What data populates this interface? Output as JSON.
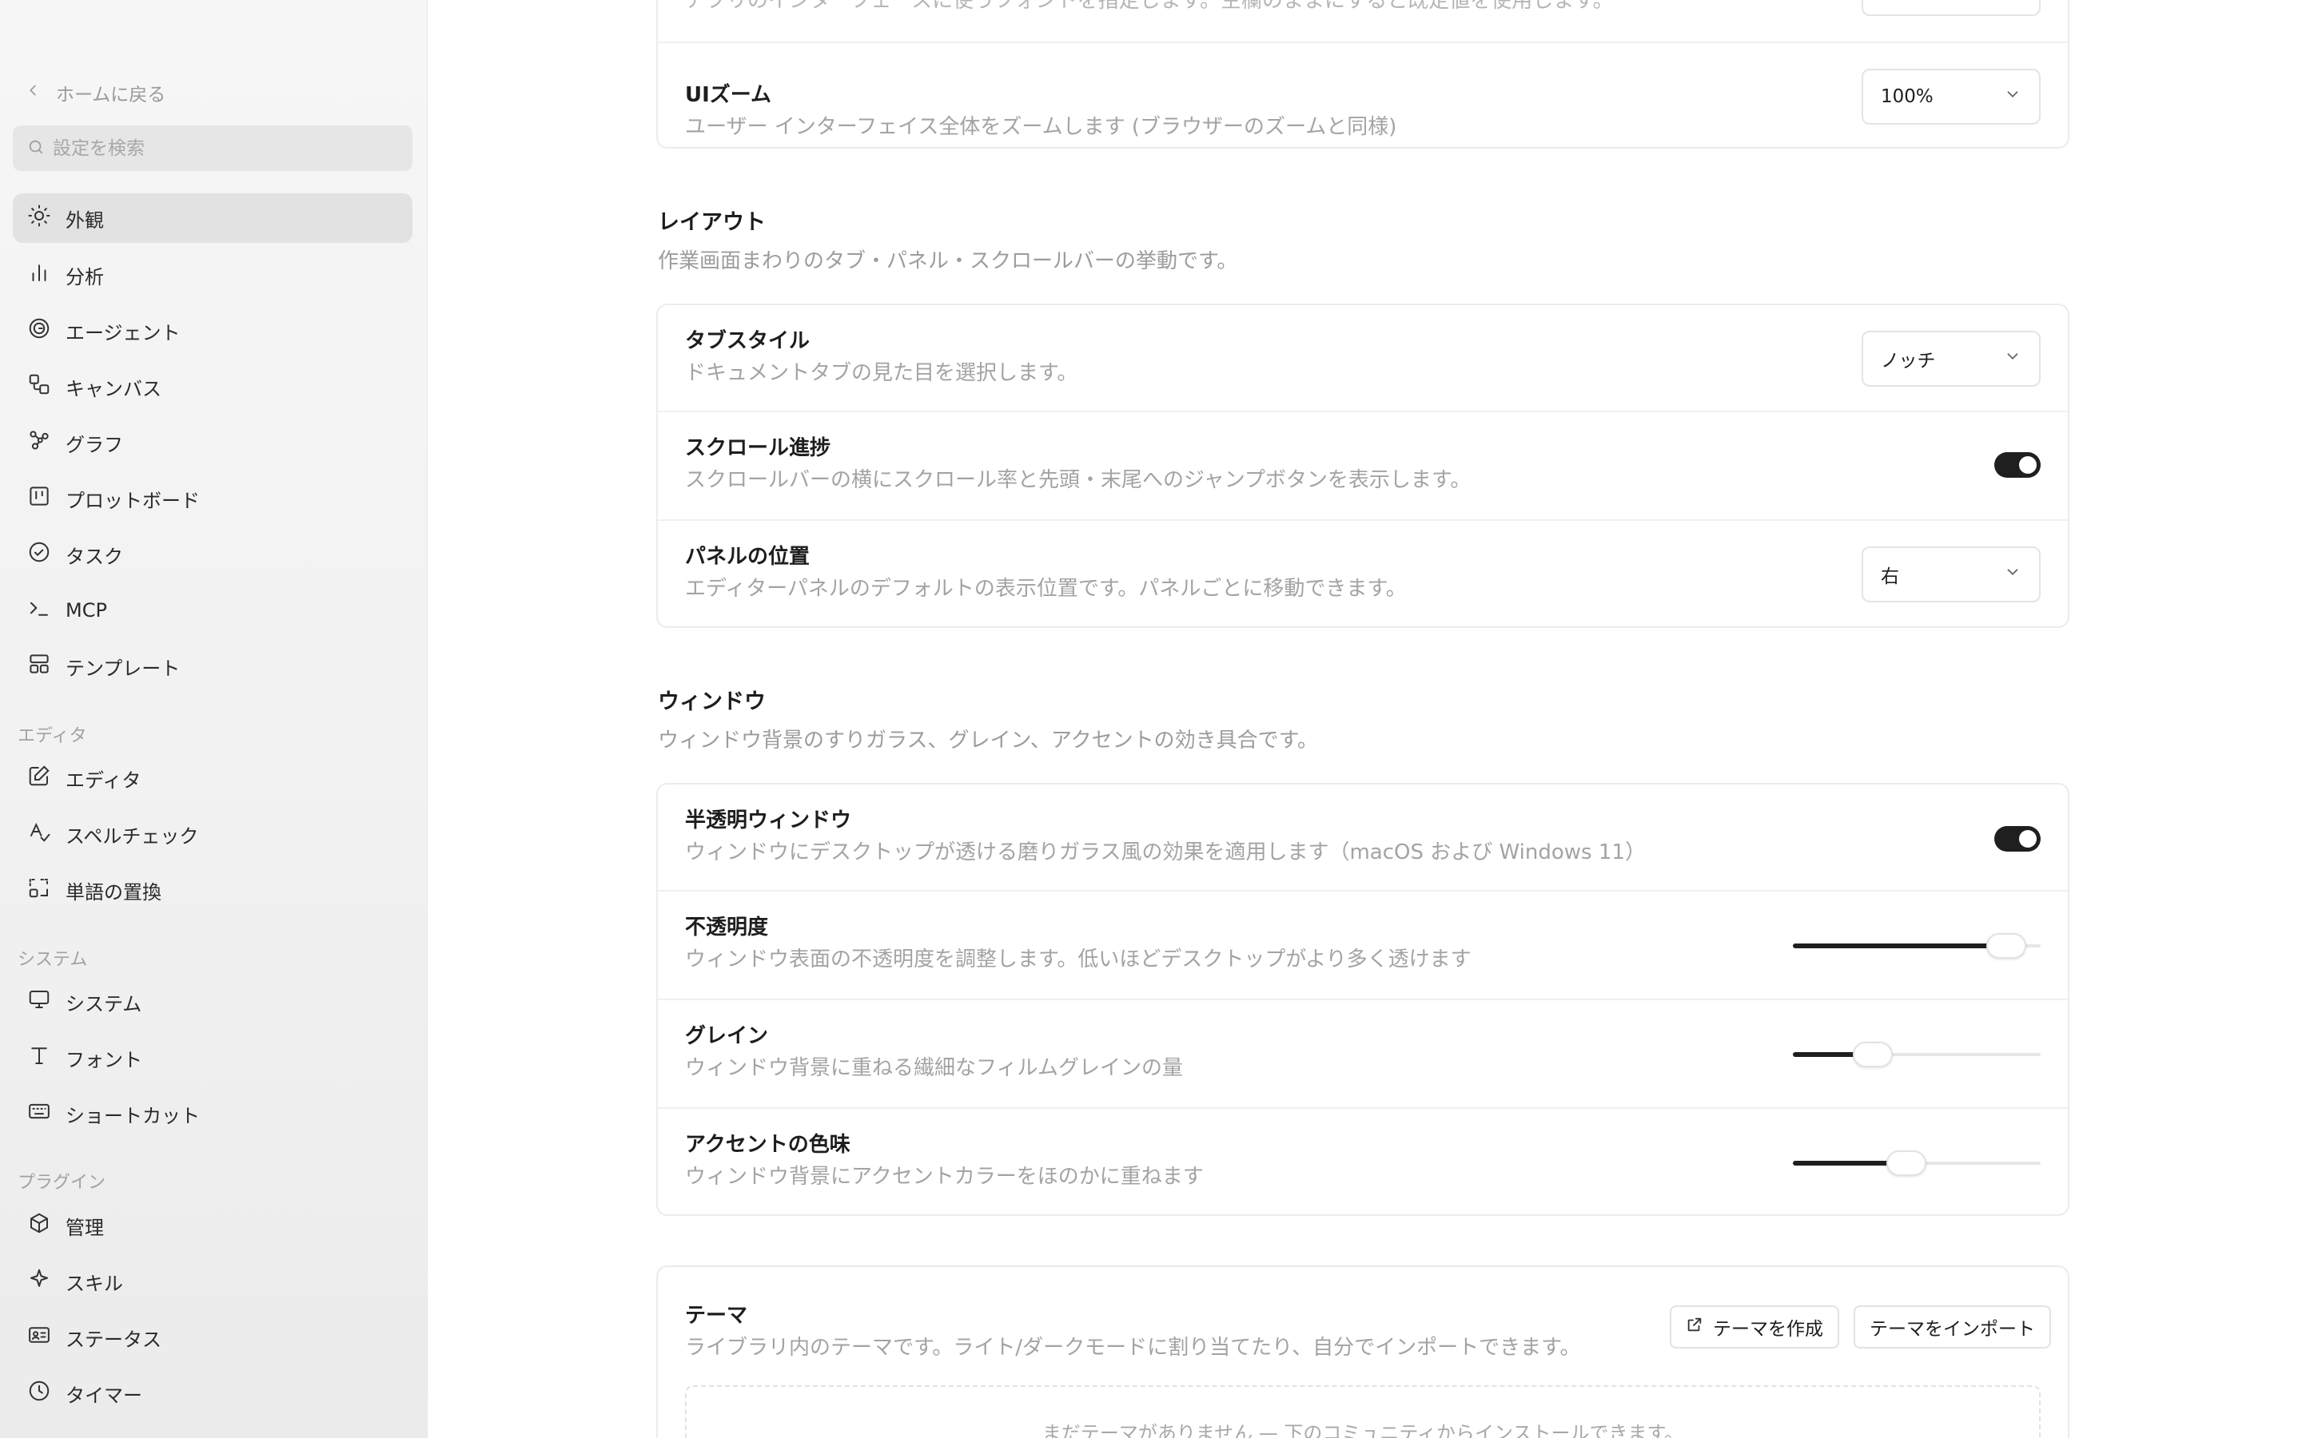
{
  "sidebar": {
    "back_label": "ホームに戻る",
    "search_placeholder": "設定を検索",
    "items": [
      {
        "label": "外観",
        "icon": "sun-icon",
        "active": true
      },
      {
        "label": "分析",
        "icon": "bar-chart-icon"
      },
      {
        "label": "エージェント",
        "icon": "spiral-icon"
      },
      {
        "label": "キャンバス",
        "icon": "canvas-icon"
      },
      {
        "label": "グラフ",
        "icon": "graph-icon"
      },
      {
        "label": "プロットボード",
        "icon": "board-icon"
      },
      {
        "label": "タスク",
        "icon": "check-circle-icon"
      },
      {
        "label": "MCP",
        "icon": "terminal-icon"
      },
      {
        "label": "テンプレート",
        "icon": "template-icon"
      }
    ],
    "groups": [
      {
        "label": "エディタ",
        "items": [
          {
            "label": "エディタ",
            "icon": "edit-icon"
          },
          {
            "label": "スペルチェック",
            "icon": "spellcheck-icon"
          },
          {
            "label": "単語の置換",
            "icon": "replace-icon"
          }
        ]
      },
      {
        "label": "システム",
        "items": [
          {
            "label": "システム",
            "icon": "monitor-icon"
          },
          {
            "label": "フォント",
            "icon": "type-icon"
          },
          {
            "label": "ショートカット",
            "icon": "keyboard-icon"
          }
        ]
      },
      {
        "label": "プラグイン",
        "items": [
          {
            "label": "管理",
            "icon": "package-icon"
          },
          {
            "label": "スキル",
            "icon": "sparkle-icon"
          },
          {
            "label": "ステータス",
            "icon": "id-card-icon"
          },
          {
            "label": "タイマー",
            "icon": "clock-icon"
          }
        ]
      }
    ]
  },
  "main": {
    "top_card": {
      "partial_desc": "アプリのインターフェースに使うフォントを指定します。空欄のままにすると既定値を使用します。",
      "ui_zoom": {
        "title": "UIズーム",
        "desc": "ユーザー インターフェイス全体をズームします (ブラウザーのズームと同様)",
        "value": "100%"
      }
    },
    "layout": {
      "title": "レイアウト",
      "desc": "作業画面まわりのタブ・パネル・スクロールバーの挙動です。",
      "tab_style": {
        "title": "タブスタイル",
        "desc": "ドキュメントタブの見た目を選択します。",
        "value": "ノッチ"
      },
      "scroll_progress": {
        "title": "スクロール進捗",
        "desc": "スクロールバーの横にスクロール率と先頭・末尾へのジャンプボタンを表示します。",
        "enabled": true
      },
      "panel_position": {
        "title": "パネルの位置",
        "desc": "エディターパネルのデフォルトの表示位置です。パネルごとに移動できます。",
        "value": "右"
      }
    },
    "window": {
      "title": "ウィンドウ",
      "desc": "ウィンドウ背景のすりガラス、グレイン、アクセントの効き具合です。",
      "translucent": {
        "title": "半透明ウィンドウ",
        "desc": "ウィンドウにデスクトップが透ける磨りガラス風の効果を適用します（macOS および Windows 11）",
        "enabled": true
      },
      "opacity": {
        "title": "不透明度",
        "desc": "ウィンドウ表面の不透明度を調整します。低いほどデスクトップがより多く透けます",
        "level": 0.93
      },
      "grain": {
        "title": "グレイン",
        "desc": "ウィンドウ背景に重ねる繊細なフィルムグレインの量",
        "level": 0.29
      },
      "accent_tint": {
        "title": "アクセントの色味",
        "desc": "ウィンドウ背景にアクセントカラーをほのかに重ねます",
        "level": 0.45
      }
    },
    "theme": {
      "title": "テーマ",
      "desc": "ライブラリ内のテーマです。ライト/ダークモードに割り当てたり、自分でインポートできます。",
      "create_label": "テーマを作成",
      "import_label": "テーマをインポート",
      "empty_text": "まだテーマがありません — 下のコミュニティからインストールできます。"
    }
  },
  "colors": {
    "toggle_on": "#1f1f1f",
    "active_nav_bg": "#e2e2e2"
  }
}
